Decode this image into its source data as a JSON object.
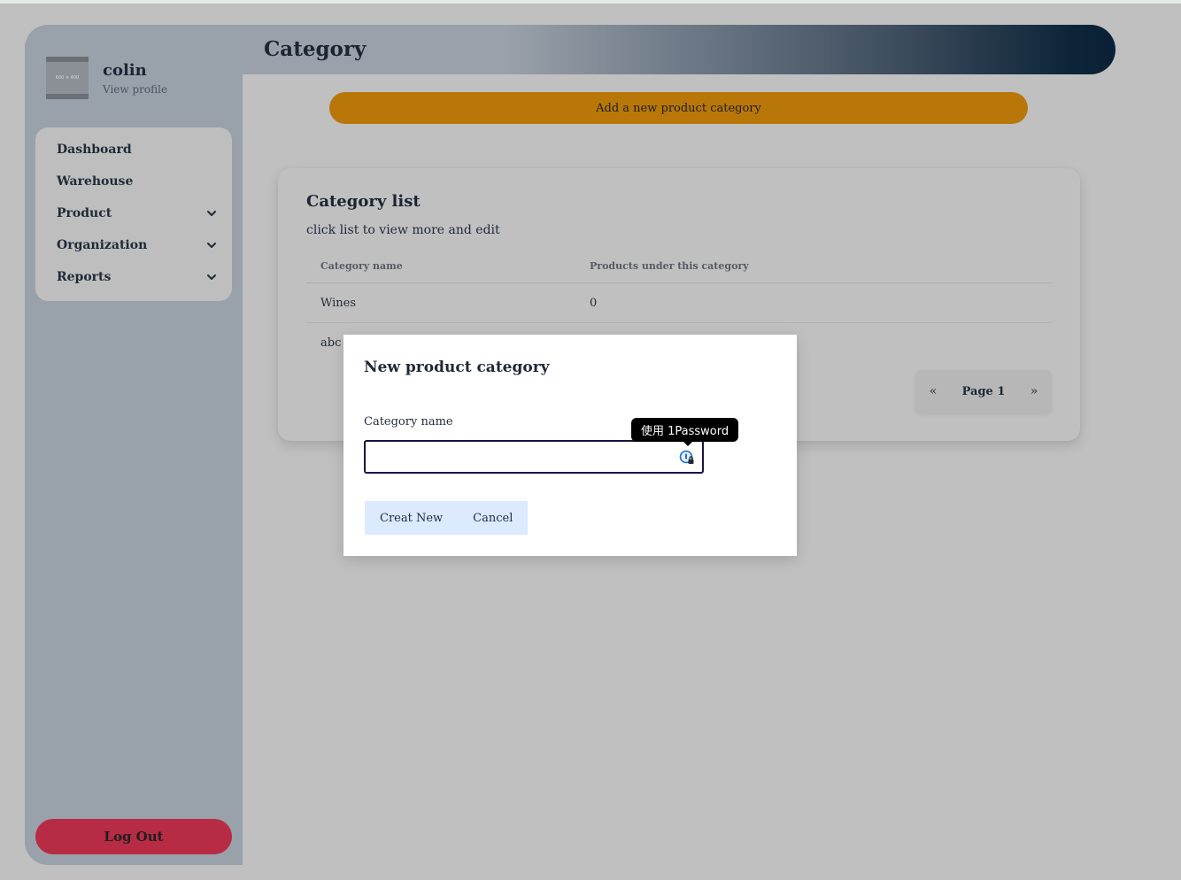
{
  "user": {
    "name": "colin",
    "profile_link": "View profile",
    "avatar_placeholder": "600 × 400"
  },
  "sidebar": {
    "items": [
      {
        "label": "Dashboard",
        "has_submenu": false
      },
      {
        "label": "Warehouse",
        "has_submenu": false
      },
      {
        "label": "Product",
        "has_submenu": true
      },
      {
        "label": "Organization",
        "has_submenu": true
      },
      {
        "label": "Reports",
        "has_submenu": true
      }
    ],
    "logout_label": "Log Out"
  },
  "header": {
    "title": "Category"
  },
  "actions": {
    "add_label": "Add a new product category"
  },
  "category_list": {
    "title": "Category list",
    "subtitle": "click list to view more and edit",
    "columns": [
      "Category name",
      "Products under this category"
    ],
    "rows": [
      {
        "name": "Wines",
        "count": "0"
      },
      {
        "name": "abc",
        "count": ""
      }
    ]
  },
  "pagination": {
    "prev": "«",
    "label": "Page 1",
    "next": "»"
  },
  "modal": {
    "title": "New product category",
    "field_label": "Category name",
    "field_value": "",
    "create_label": "Creat New",
    "cancel_label": "Cancel"
  },
  "password_manager": {
    "tooltip": "使用 1Password"
  },
  "colors": {
    "sidebar": "#99a1ab",
    "accent_orange": "#b97709",
    "logout_red": "#b72b45",
    "header_dark": "#0a2036",
    "modal_buttons_bg": "#dbeafe"
  }
}
